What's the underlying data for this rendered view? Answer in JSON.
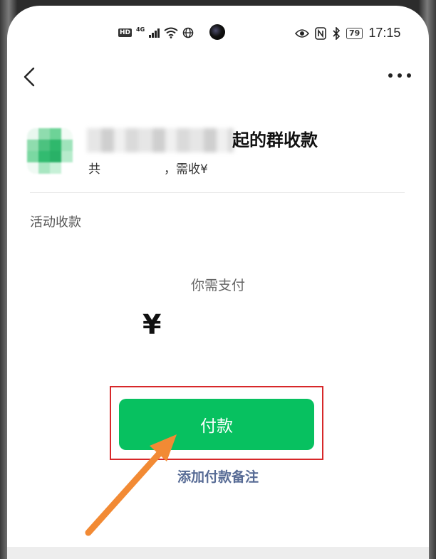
{
  "status_bar": {
    "hd": "HD",
    "network": "4G",
    "battery": "79",
    "time": "17:15"
  },
  "nav": {
    "back_icon": "chevron-left-icon",
    "more_icon": "more-dots-icon"
  },
  "header": {
    "title_suffix": "起的群收款",
    "subtitle_prefix": "共",
    "subtitle_suffix": "，需收¥"
  },
  "section_label": "活动收款",
  "payment": {
    "prompt": "你需支付",
    "currency_symbol": "¥",
    "pay_button_label": "付款",
    "add_note_label": "添加付款备注"
  },
  "colors": {
    "accent_green": "#07c160",
    "link_blue": "#576b95",
    "highlight_red": "#d7282a",
    "arrow_orange": "#f28a34"
  }
}
